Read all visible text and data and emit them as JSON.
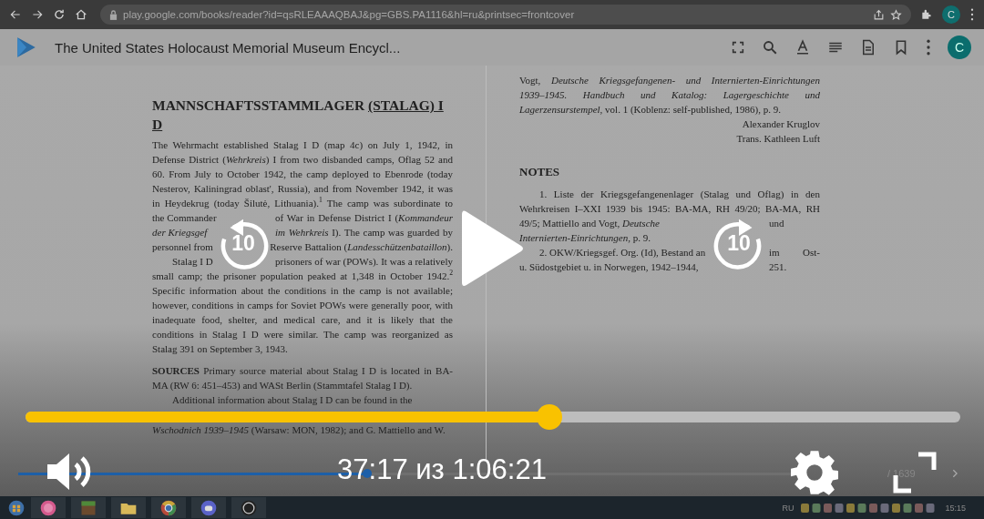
{
  "browser": {
    "url": "play.google.com/books/reader?id=qsRLEAAAQBAJ&pg=GBS.PA1116&hl=ru&printsec=frontcover",
    "avatar": "C"
  },
  "reader": {
    "title": "The United States Holocaust Memorial Museum Encycl...",
    "avatar": "C"
  },
  "left_page": {
    "heading": "MANNSCHAFTSSTAMMLAGER",
    "heading_link_lines": [
      "(STALAG) I",
      "D"
    ],
    "paragraphs": [
      {
        "kind": "body",
        "indent": false,
        "lines": [
          "The Wehrmacht established Stalag I D (map 4c) on July 1, 1942, in",
          "Defense District (*Wehrkreis*) I from two disbanded camps, Oflag 52 and",
          "60. From July to October 1942, the camp deployed to Ebenrode (today",
          "Nesterov, Kaliningrad oblast', Russia), and from November 1942, it was",
          "in Heydekrug (today Šilutė, Lithuania).$^{1}$ The camp was subordinate to",
          [
            "the Commander",
            "of War in Defense District I (*Kommandeur*"
          ],
          [
            "*der Kriegsgef*",
            "*im Wehrkreis* I). The camp was guarded by"
          ],
          [
            "personnel from",
            "Reserve Battalion (*Landesschützenbataillon*)."
          ]
        ]
      },
      {
        "kind": "body",
        "indent": true,
        "lines": [
          [
            "Stalag I D",
            "prisoners of war (POWs). It was a relatively"
          ],
          "small camp; the prisoner population peaked at 1,348 in October 1942.$^{2}$",
          "Specific information about the conditions in the camp is not available;",
          "however, conditions in camps for Soviet POWs were generally poor, with",
          "inadequate food, shelter, and medical care, and it is likely that the",
          "conditions in Stalag I D were similar. The camp was reorganized as",
          "Stalag 391 on September 3, 1943."
        ]
      },
      {
        "kind": "sources",
        "indent": false,
        "lines": [
          "**SOURCES** Primary source material about Stalag I D is located in BA-",
          "MA (RW 6: 451–453) and WASt Berlin (Stammtafel Stalag I D)."
        ]
      },
      {
        "kind": "body",
        "indent": true,
        "lines": [
          "Additional information about Stalag I D can be found in the"
        ]
      },
      {
        "kind": "continuation",
        "indent": false,
        "lines": [
          "*Wschodnich 1939–1945* (Warsaw: MON, 1982); and G. Mattiello and W."
        ]
      }
    ]
  },
  "right_page": {
    "lines": [
      "Vogt, *Deutsche Kriegsgefangenen- und Internierten-Einrichtungen*",
      "*1939–1945. Handbuch und Katalog: Lagergeschichte und*",
      "*Lagerzensurstempel*, vol. 1 (Koblenz: self-published, 1986), p. 9."
    ],
    "signature": [
      "Alexander Kruglov",
      "Trans. Kathleen Luft"
    ],
    "notes_heading": "NOTES",
    "notes": [
      {
        "lines": [
          "1. Liste der Kriegsgefangenenlager (Stalag und Oflag) in den",
          "Wehrkreisen I–XXI 1939 bis 1945: BA-MA, RH 49/20; BA-MA, RH",
          [
            "49/5; Mattiello and Vogt, *Deutsche*",
            "und"
          ],
          "*Internierten-Einrichtungen*, p. 9."
        ]
      },
      {
        "lines": [
          [
            "2. OKW/Kriegsgef. Org. (Id), Bestand an",
            "im Ost-"
          ],
          [
            "u. Südostgebiet u. in Norwegen, 1942–1944,",
            "251."
          ]
        ]
      }
    ]
  },
  "reader_footer": {
    "level": 0.45,
    "page": "/ 1639"
  },
  "taskbar": {
    "language": "RU",
    "time": "15:15"
  },
  "player": {
    "level": 0.56,
    "time": "37:17 из 1:06:21",
    "rewind": "10",
    "forward": "10"
  }
}
